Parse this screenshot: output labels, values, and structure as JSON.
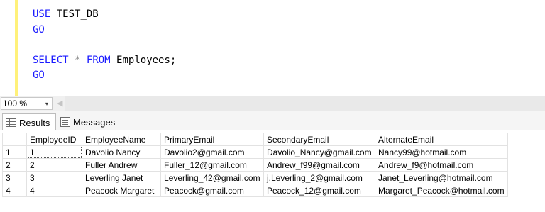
{
  "editor": {
    "line1": {
      "kw": "USE",
      "rest": " TEST_DB"
    },
    "line2": {
      "kw": "GO"
    },
    "line4": {
      "kw1": "SELECT",
      "op": "*",
      "kw2": "FROM",
      "table": "Employees;"
    },
    "line5": {
      "kw": "GO"
    }
  },
  "zoom": {
    "value": "100 %",
    "arrow": "▾",
    "scroll": "◀"
  },
  "tabs": [
    {
      "label": "Results",
      "icon": "grid-icon"
    },
    {
      "label": "Messages",
      "icon": "messages-icon"
    }
  ],
  "grid": {
    "columns": [
      "EmployeeID",
      "EmployeeName",
      "PrimaryEmail",
      "SecondaryEmail",
      "AlternateEmail"
    ],
    "rows": [
      {
        "num": "1",
        "cells": [
          "1",
          "Davolio Nancy",
          "Davolio2@gmail.com",
          "Davolio_Nancy@gmail.com",
          "Nancy99@hotmail.com"
        ]
      },
      {
        "num": "2",
        "cells": [
          "2",
          "Fuller Andrew",
          "Fuller_12@gmail.com",
          "Andrew_f99@gmail.com",
          "Andrew_f9@hotmail.com"
        ]
      },
      {
        "num": "3",
        "cells": [
          "3",
          "Leverling Janet",
          "Leverling_42@gmail.com",
          "j.Leverling_2@gmail.com",
          "Janet_Leverling@hotmail.com"
        ]
      },
      {
        "num": "4",
        "cells": [
          "4",
          "Peacock Margaret",
          "Peacock@gmail.com",
          "Peacock_12@gmail.com",
          "Margaret_Peacock@hotmail.com"
        ]
      }
    ]
  },
  "colors": {
    "keyword": "#1a1aff",
    "operator": "#8c8c8c",
    "gutter": "#fff17a"
  }
}
